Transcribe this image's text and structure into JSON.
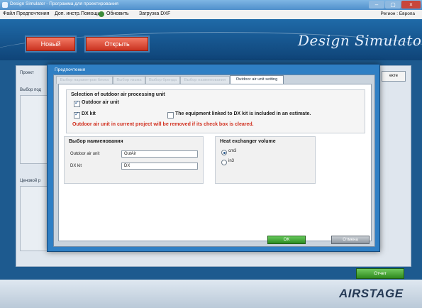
{
  "window": {
    "title": "Design Simulator - Программа для проектирования",
    "controls": {
      "minimize": "–",
      "maximize": "▢",
      "close": "×"
    }
  },
  "menu": {
    "items": [
      "Файл",
      "Предпочтения",
      "Доп. инстр.",
      "Помощь",
      "Обновить",
      "Загрузка DXF"
    ],
    "region": "Регион : Европа"
  },
  "toolbar": {
    "new_label": "Новый",
    "open_label": "Открыть"
  },
  "banner": {
    "logo": "Design Simulator"
  },
  "background": {
    "left_tabs": [
      "Проект",
      "Выбор под",
      "Ценовой р"
    ],
    "right_tab": "екте",
    "report_label": "Отчет",
    "footer_logo": "AIRSTAGE"
  },
  "dialog": {
    "title": "Предпочтения",
    "tabs": [
      "Выбор параметров блока",
      "Выбор языка",
      "Выбор бренда",
      "Выбор наименования",
      "Outdoor air unit setting"
    ],
    "active_tab": "Outdoor air unit setting",
    "selection": {
      "title": "Selection of outdoor air processing unit",
      "outdoor_air_unit": {
        "label": "Outdoor air unit",
        "checked": true
      },
      "dx_kit": {
        "label": "DX kit",
        "checked": true
      },
      "estimate": {
        "label": "The equipment linked to DX kit is included in an estimate.",
        "checked": false
      },
      "warning": "Outdoor air unit in current project will be removed if its check box is cleared."
    },
    "naming": {
      "title": "Выбор наименования",
      "fields": [
        {
          "label": "Outdoor air unit",
          "value": "OutAir"
        },
        {
          "label": "DX kit",
          "value": "DX"
        }
      ]
    },
    "heat_exchanger": {
      "title": "Heat exchanger volume",
      "options": [
        {
          "label": "cm3",
          "selected": true
        },
        {
          "label": "in3",
          "selected": false
        }
      ]
    },
    "buttons": {
      "ok": "OK",
      "cancel": "Отмена"
    }
  }
}
